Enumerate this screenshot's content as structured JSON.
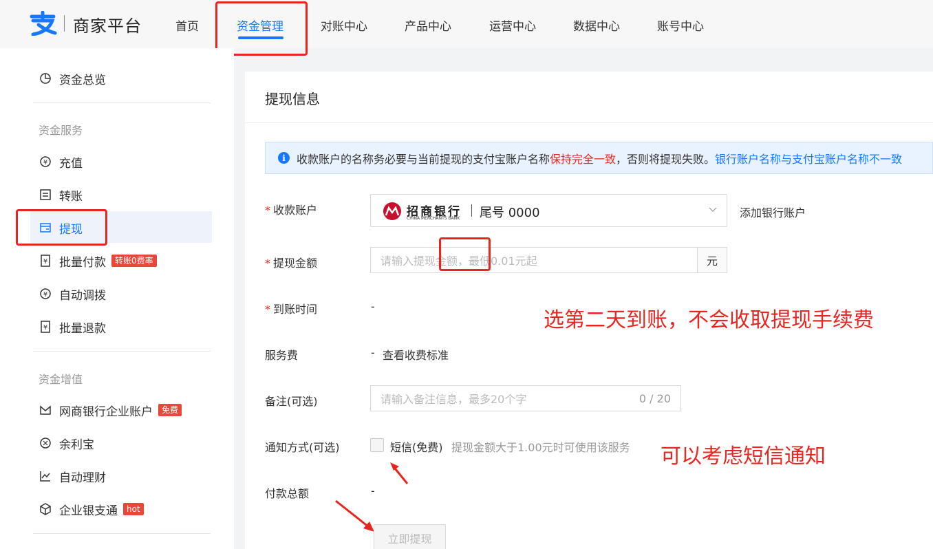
{
  "header": {
    "logo_text": "商家平台",
    "nav": [
      "首页",
      "资金管理",
      "对账中心",
      "产品中心",
      "运营中心",
      "数据中心",
      "账号中心"
    ],
    "active_nav": "资金管理"
  },
  "sidebar": {
    "overview": "资金总览",
    "group1_title": "资金服务",
    "items1": [
      "充值",
      "转账",
      "提现",
      "批量付款",
      "自动调拨",
      "批量退款"
    ],
    "batch_pay_tag": "转账0费率",
    "group2_title": "资金增值",
    "items2": [
      "网商银行企业账户",
      "余利宝",
      "自动理财",
      "企业银支通"
    ],
    "mybank_tag": "免费",
    "bank_link_tag": "hot"
  },
  "card": {
    "title": "提现信息",
    "notice": {
      "part1": "收款账户的名称务必要与当前提现的支付宝账户名称",
      "part_red": "保持完全一致",
      "part2": "，否则将提现失败。",
      "link": "银行账户名称与支付宝账户名称不一致"
    },
    "form": {
      "account_label": "收款账户",
      "bank_name": "招商银行",
      "bank_name_en": "CHINA MERCHANTS BANK",
      "tail_label": "尾号 0000",
      "add_bank_link": "添加银行账户",
      "amount_label": "提现金额",
      "amount_placeholder": "请输入提现金额，最低0.01元起",
      "amount_unit": "元",
      "arrival_label": "到账时间",
      "arrival_value": "-",
      "fee_label": "服务费",
      "fee_value": "-",
      "fee_link": "查看收费标准",
      "note_label": "备注(可选)",
      "note_placeholder": "请输入备注信息，最多20个字",
      "note_count": "0 / 20",
      "notify_label": "通知方式(可选)",
      "sms_label": "短信(免费)",
      "sms_hint": "提现金额大于1.00元时可使用该服务",
      "total_label": "付款总额",
      "total_value": "-",
      "submit": "立即提现"
    }
  },
  "annotations": {
    "arrival_note": "选第二天到账，不会收取提现手续费",
    "sms_note": "可以考虑短信通知"
  },
  "colors": {
    "primary": "#1677ff",
    "danger": "#e8261f",
    "notice_bg": "#e9f3ff"
  }
}
